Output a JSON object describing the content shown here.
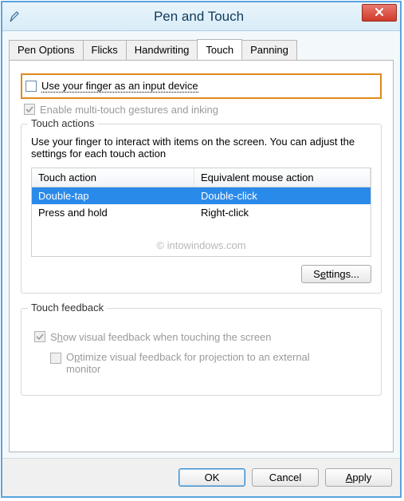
{
  "window": {
    "title": "Pen and Touch"
  },
  "tabs": {
    "pen_options": "Pen Options",
    "flicks": "Flicks",
    "handwriting": "Handwriting",
    "touch": "Touch",
    "panning": "Panning"
  },
  "touch_tab": {
    "use_finger_label": "Use your finger as an input device",
    "enable_multitouch_label": "Enable multi-touch gestures and inking",
    "touch_actions": {
      "legend": "Touch actions",
      "desc": "Use your finger to interact with items on the screen. You can adjust the settings for each touch action",
      "col_action": "Touch action",
      "col_mouse": "Equivalent mouse action",
      "rows": [
        {
          "action": "Double-tap",
          "mouse": "Double-click",
          "selected": true
        },
        {
          "action": "Press and hold",
          "mouse": "Right-click",
          "selected": false
        }
      ],
      "settings_btn_pre": "S",
      "settings_btn_mid": "e",
      "settings_btn_post": "ttings..."
    },
    "touch_feedback": {
      "legend": "Touch feedback",
      "show_feedback_pre": "S",
      "show_feedback_mid": "h",
      "show_feedback_post": "ow visual feedback when touching the screen",
      "optimize_pre": "O",
      "optimize_mid": "p",
      "optimize_post": "timize visual feedback for projection to an external monitor"
    }
  },
  "watermark": "© intowindows.com",
  "buttons": {
    "ok": "OK",
    "cancel": "Cancel",
    "apply_pre": "",
    "apply_mid": "A",
    "apply_post": "pply"
  }
}
